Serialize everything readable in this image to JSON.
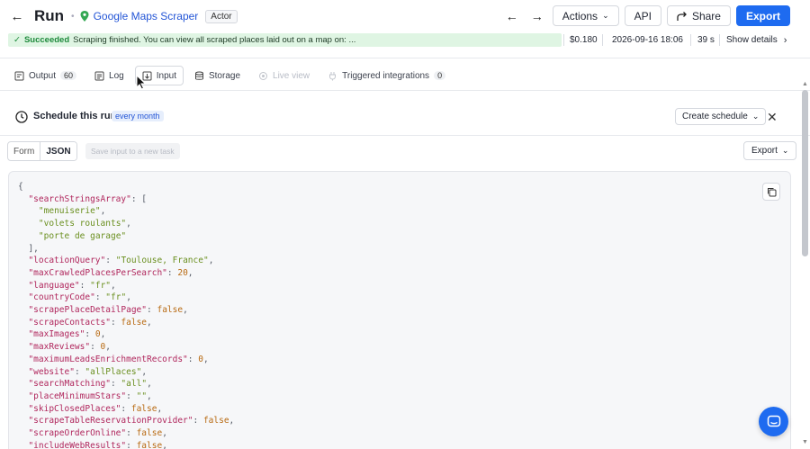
{
  "header": {
    "title": "Run",
    "actor_name": "Google Maps Scraper",
    "actor_badge": "Actor",
    "actions_label": "Actions",
    "api_label": "API",
    "share_label": "Share",
    "export_label": "Export"
  },
  "status": {
    "state": "Succeeded",
    "message": "Scraping finished. You can view all scraped places laid out on a map on: ...",
    "cost": "$0.180",
    "datetime": "2026-09-16 18:06",
    "duration": "39 s",
    "details_label": "Show details"
  },
  "tabs": [
    {
      "label": "Output",
      "count": "60"
    },
    {
      "label": "Log"
    },
    {
      "label": "Input"
    },
    {
      "label": "Storage"
    },
    {
      "label": "Live view"
    },
    {
      "label": "Triggered integrations",
      "count": "0"
    }
  ],
  "schedule": {
    "title": "Schedule this run",
    "badge": "every month",
    "create_label": "Create schedule"
  },
  "input_toolbar": {
    "form_label": "Form",
    "json_label": "JSON",
    "save_label": "Save input to a new task",
    "export_label": "Export"
  },
  "json_input": {
    "searchStringsArray": [
      "menuiserie",
      "volets roulants",
      "porte de garage"
    ],
    "locationQuery": "Toulouse, France",
    "maxCrawledPlacesPerSearch": "20",
    "language": "fr",
    "countryCode": "fr",
    "scrapePlaceDetailPage": "false",
    "scrapeContacts": "false",
    "maxImages": "0",
    "maxReviews": "0",
    "maximumLeadsEnrichmentRecords": "0",
    "website": "allPlaces",
    "searchMatching": "all",
    "placeMinimumStars": "",
    "skipClosedPlaces": "false",
    "scrapeTableReservationProvider": "false",
    "scrapeOrderOnline": "false",
    "includeWebResults": "false"
  },
  "colors": {
    "accent": "#1e6bf0",
    "success_bg": "#dff5e3",
    "success_text": "#1e8a3c"
  }
}
